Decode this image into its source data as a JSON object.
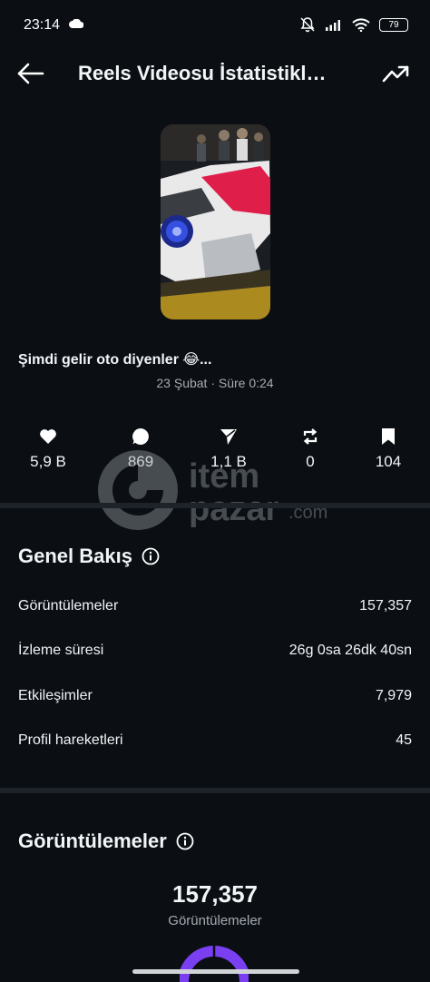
{
  "status_bar": {
    "time": "23:14",
    "battery": "79",
    "icons": [
      "cloud-icon",
      "muted-bell-icon",
      "signal-icon",
      "wifi-icon",
      "battery-icon"
    ]
  },
  "header": {
    "title": "Reels Videosu İstatistikl…",
    "back_icon": "arrow-left-icon",
    "trend_icon": "trending-up-icon"
  },
  "post": {
    "caption": "Şimdi gelir oto diyenler 😂...",
    "meta": "23 Şubat · Süre 0:24"
  },
  "stats": [
    {
      "icon": "heart-icon",
      "value": "5,9 B"
    },
    {
      "icon": "comment-icon",
      "value": "869"
    },
    {
      "icon": "send-icon",
      "value": "1,1 B"
    },
    {
      "icon": "repost-icon",
      "value": "0"
    },
    {
      "icon": "bookmark-icon",
      "value": "104"
    }
  ],
  "watermark": {
    "line1": "item",
    "line2": "pazar",
    "suffix": ".com"
  },
  "overview": {
    "title": "Genel Bakış",
    "rows": [
      {
        "label": "Görüntülemeler",
        "value": "157,357"
      },
      {
        "label": "İzleme süresi",
        "value": "26g 0sa 26dk 40sn"
      },
      {
        "label": "Etkileşimler",
        "value": "7,979"
      },
      {
        "label": "Profil hareketleri",
        "value": "45"
      }
    ]
  },
  "views": {
    "title": "Görüntülemeler",
    "total": "157,357",
    "label": "Görüntülemeler"
  },
  "colors": {
    "background": "#0b0f14",
    "divider": "#1e2329",
    "donut_accent": "#7b3ff2"
  }
}
